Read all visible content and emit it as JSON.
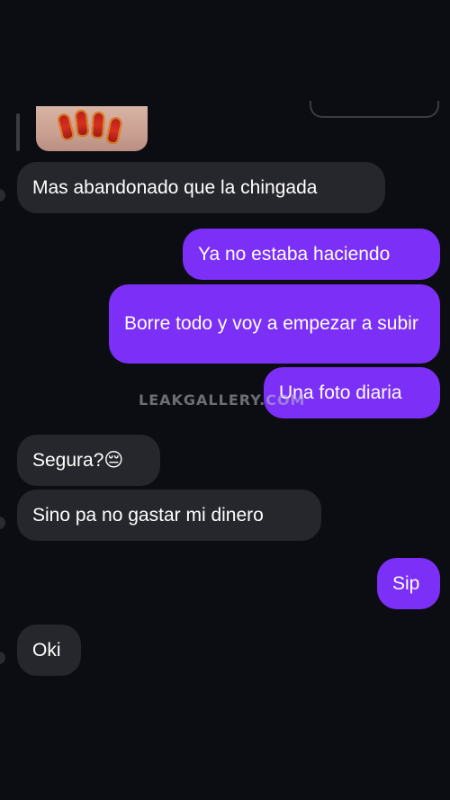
{
  "watermark": "LEAKGALLERY.COM",
  "messages": [
    {
      "direction": "in",
      "text": "Mas abandonado que la chingada"
    },
    {
      "direction": "out",
      "text": "Ya no estaba haciendo"
    },
    {
      "direction": "out",
      "text": "Borre todo y voy a empezar a subir"
    },
    {
      "direction": "out",
      "text": "Una foto diaria"
    },
    {
      "direction": "in",
      "text": "Segura?😔"
    },
    {
      "direction": "in",
      "text": "Sino pa no gastar mi dinero"
    },
    {
      "direction": "out",
      "text": "Sip"
    },
    {
      "direction": "in",
      "text": "Oki"
    }
  ],
  "colors": {
    "background": "#0c0d12",
    "incoming_bubble": "#26272c",
    "outgoing_bubble": "#7b2ff7"
  }
}
